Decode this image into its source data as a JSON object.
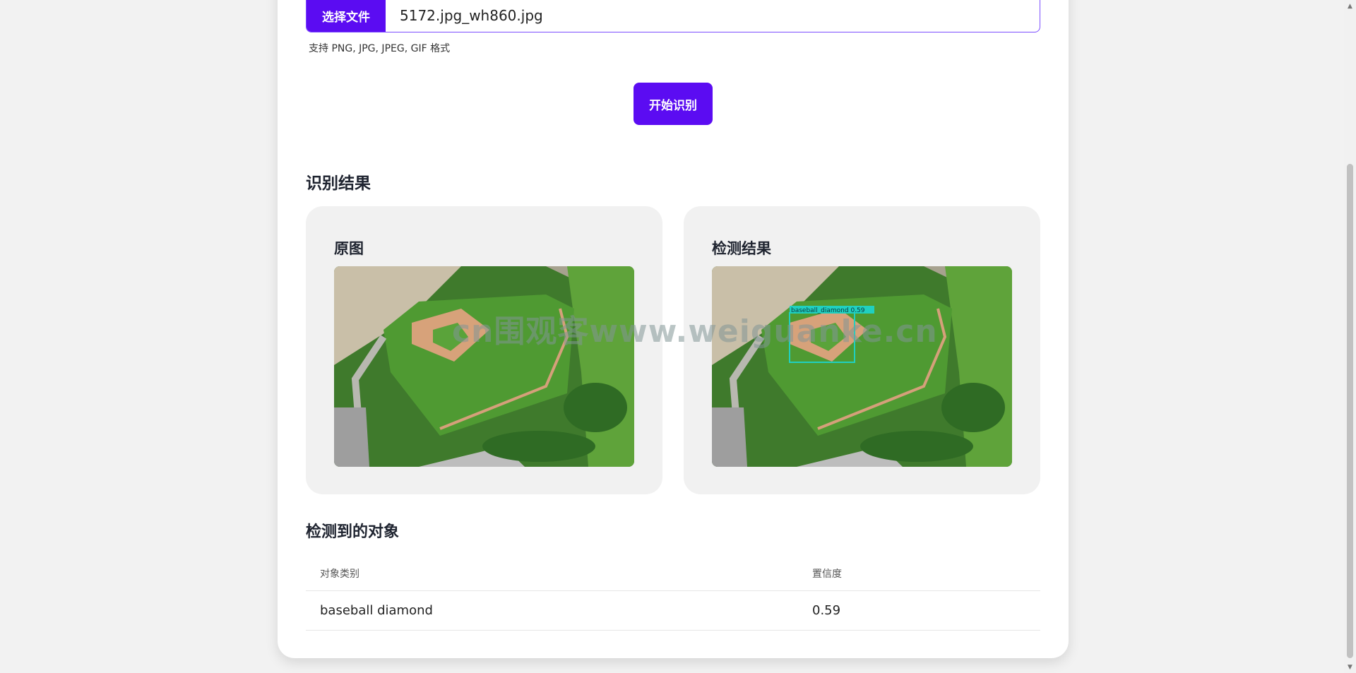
{
  "upload": {
    "choose_label": "选择文件",
    "file_name": "5172.jpg_wh860.jpg",
    "hint": "支持 PNG, JPG, JPEG, GIF 格式"
  },
  "start_label": "开始识别",
  "results": {
    "title": "识别结果",
    "original_title": "原图",
    "detected_title": "检测结果",
    "detection_label": "baseball_diamond 0.59"
  },
  "objects": {
    "title": "检测到的对象",
    "columns": [
      "对象类别",
      "置信度"
    ],
    "rows": [
      {
        "category": "baseball diamond",
        "confidence": "0.59"
      }
    ]
  },
  "watermark": "cn围观客www.weiguanke.cn",
  "colors": {
    "accent": "#5b0cf2",
    "box": "#20d0c0"
  }
}
